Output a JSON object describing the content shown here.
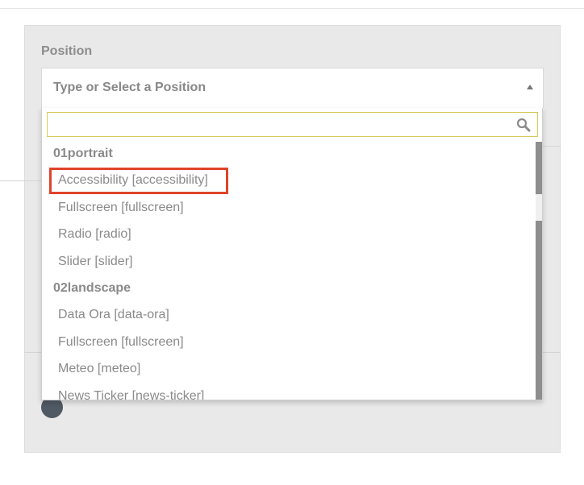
{
  "field": {
    "label": "Position",
    "placeholder": "Type or Select a Position",
    "caret_icon": "caret-up-icon"
  },
  "search": {
    "value": "",
    "placeholder": "",
    "icon": "search-icon"
  },
  "dropdown": {
    "groups": [
      {
        "label": "01portrait",
        "options": [
          {
            "label": "Accessibility [accessibility]",
            "highlighted": true
          },
          {
            "label": "Fullscreen [fullscreen]"
          },
          {
            "label": "Radio [radio]"
          },
          {
            "label": "Slider [slider]"
          }
        ]
      },
      {
        "label": "02landscape",
        "options": [
          {
            "label": "Data Ora [data-ora]"
          },
          {
            "label": "Fullscreen [fullscreen]"
          },
          {
            "label": "Meteo [meteo]"
          },
          {
            "label": "News Ticker [news-ticker]"
          }
        ]
      }
    ]
  },
  "colors": {
    "highlight_border": "#e0432b",
    "search_border": "#d7c95a",
    "panel_bg": "#e9e9e9"
  }
}
